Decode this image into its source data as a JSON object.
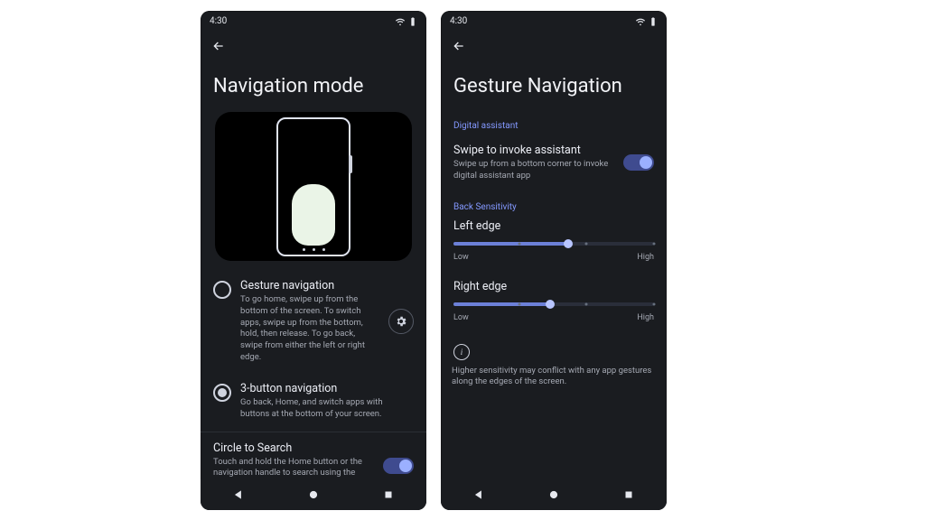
{
  "statusbar": {
    "time": "4:30"
  },
  "left": {
    "title": "Navigation mode",
    "options": [
      {
        "title": "Gesture navigation",
        "desc": "To go home, swipe up from the bottom of the screen. To switch apps, swipe up from the bottom, hold, then release. To go back, swipe from either the left or right edge.",
        "selected": false,
        "gear": true
      },
      {
        "title": "3-button navigation",
        "desc": "Go back, Home, and switch apps with buttons at the bottom of your screen.",
        "selected": true,
        "gear": false
      }
    ],
    "circle": {
      "title": "Circle to Search",
      "desc": "Touch and hold the Home button or the navigation handle to search using the content on your screen."
    }
  },
  "right": {
    "title": "Gesture Navigation",
    "section_assistant": "Digital assistant",
    "assistant": {
      "title": "Swipe to invoke assistant",
      "desc": "Swipe up from a bottom corner to invoke digital assistant app"
    },
    "section_back": "Back Sensitivity",
    "sliders": {
      "left_label": "Left edge",
      "right_label": "Right edge",
      "low": "Low",
      "high": "High",
      "left_value_pct": 57,
      "right_value_pct": 48
    },
    "info": "Higher sensitivity may conflict with any app gestures along the edges of the screen."
  }
}
